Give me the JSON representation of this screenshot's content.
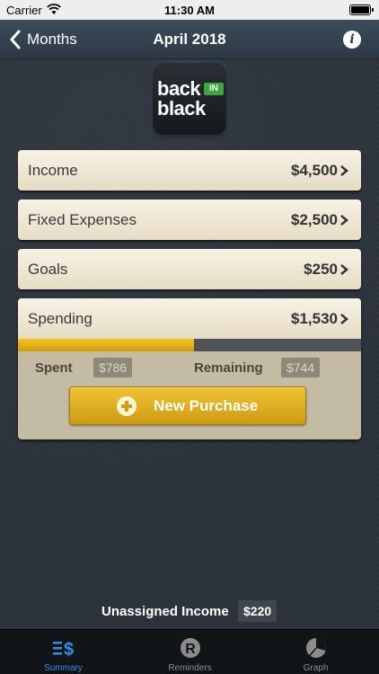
{
  "status_bar": {
    "carrier": "Carrier",
    "time": "11:30 AM"
  },
  "nav": {
    "back_label": "Months",
    "title": "April 2018"
  },
  "logo": {
    "line1": "back",
    "badge": "IN",
    "line2": "black"
  },
  "rows": [
    {
      "label": "Income",
      "value": "$4,500"
    },
    {
      "label": "Fixed Expenses",
      "value": "$2,500"
    },
    {
      "label": "Goals",
      "value": "$250"
    }
  ],
  "spending": {
    "label": "Spending",
    "value": "$1,530",
    "progress_fraction": 0.514,
    "spent_label": "Spent",
    "spent_value": "$786",
    "remaining_label": "Remaining",
    "remaining_value": "$744",
    "button_label": "New Purchase"
  },
  "unassigned": {
    "label": "Unassigned Income",
    "value": "$220"
  },
  "tabs": [
    {
      "label": "Summary",
      "icon": "summary-icon",
      "active": true
    },
    {
      "label": "Reminders",
      "icon": "reminders-icon",
      "active": false
    },
    {
      "label": "Graph",
      "icon": "graph-icon",
      "active": false
    }
  ],
  "colors": {
    "accent_blue": "#2f8fe8",
    "progress_gold": "#f3c421",
    "logo_green": "#3ea53e"
  }
}
